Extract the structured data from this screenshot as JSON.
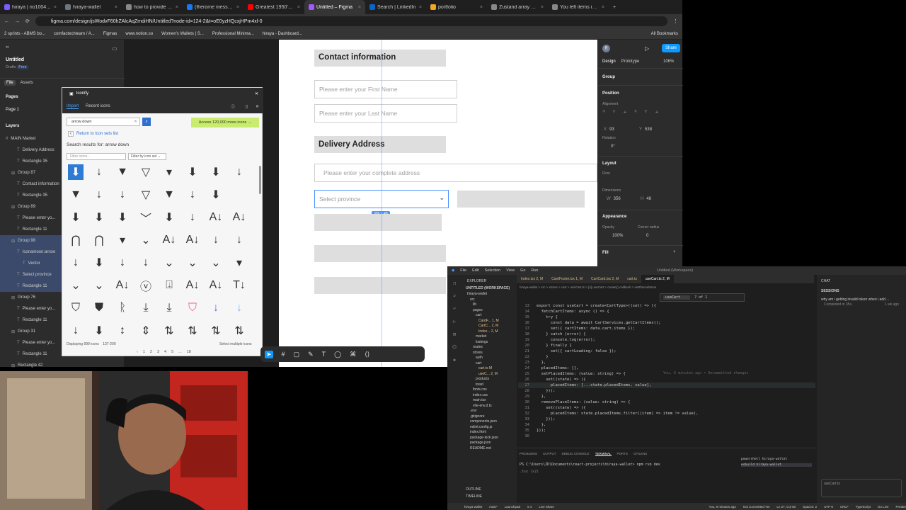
{
  "browser": {
    "tabs": [
      {
        "label": "hiraya | rio1004's Org",
        "color": "#7c5cff"
      },
      {
        "label": "hiraya-wallet",
        "color": "#6e7681"
      },
      {
        "label": "how to provide the lin",
        "color": "#888888"
      },
      {
        "label": "(fherome messaged TH",
        "color": "#1877f2"
      },
      {
        "label": "Greatest 1950's Sci",
        "color": "#ff0000"
      },
      {
        "label": "Untitled – Figma",
        "color": "#a259ff",
        "active": true
      },
      {
        "label": "Search | LinkedIn",
        "color": "#0a66c2"
      },
      {
        "label": "portfolio",
        "color": "#f5a623"
      },
      {
        "label": "Zustand array push g",
        "color": "#888888"
      },
      {
        "label": "You left items in your",
        "color": "#888888"
      }
    ],
    "url": "figma.com/design/jsWodvF60hZAlcAqZmdiHN/Untitled?node-id=124-2&t=oE0yzHQcxjHPm4xl-0",
    "bookmarks": [
      "2 sprints - ABMS bo...",
      "comfactechteam / A...",
      "Figmas",
      "www.notion.so",
      "Women's Wallets | S...",
      "Professional Minima...",
      "hiraya - Dashboard..."
    ],
    "all_bookmarks": "All Bookmarks"
  },
  "figma": {
    "file_title": "Untitled",
    "drafts": "Drafts",
    "free_badge": "Free",
    "tabs": [
      "File",
      "Assets"
    ],
    "pages_heading": "Pages",
    "page_item": "Page 1",
    "layers_heading": "Layers",
    "layers": [
      {
        "label": "MAIN Market",
        "indent": 0,
        "selected": false
      },
      {
        "label": "Delivery Address",
        "indent": 2,
        "selected": false
      },
      {
        "label": "Rectangle 35",
        "indent": 2,
        "selected": false
      },
      {
        "label": "Group 87",
        "indent": 1,
        "selected": false
      },
      {
        "label": "Contact information",
        "indent": 2,
        "selected": false
      },
      {
        "label": "Rectangle 35",
        "indent": 2,
        "selected": false
      },
      {
        "label": "Group 89",
        "indent": 1,
        "selected": false
      },
      {
        "label": "Please enter yo...",
        "indent": 2,
        "selected": false
      },
      {
        "label": "Rectangle 11",
        "indent": 2,
        "selected": false
      },
      {
        "label": "Group 98",
        "indent": 1,
        "selected": true
      },
      {
        "label": "Iconamoon:arrow",
        "indent": 2,
        "selected": true
      },
      {
        "label": "Vector",
        "indent": 3,
        "selected": true
      },
      {
        "label": "Select province",
        "indent": 2,
        "selected": true
      },
      {
        "label": "Rectangle 11",
        "indent": 2,
        "selected": true
      },
      {
        "label": "Group 76",
        "indent": 1,
        "selected": false
      },
      {
        "label": "Please enter yo...",
        "indent": 2,
        "selected": false
      },
      {
        "label": "Rectangle 11",
        "indent": 2,
        "selected": false
      },
      {
        "label": "Group 31",
        "indent": 1,
        "selected": false
      },
      {
        "label": "Please enter yo...",
        "indent": 2,
        "selected": false
      },
      {
        "label": "Rectangle 11",
        "indent": 2,
        "selected": false
      },
      {
        "label": "Rectangle 42",
        "indent": 1,
        "selected": false
      }
    ],
    "canvas": {
      "contact_heading": "Contact information",
      "first_name_ph": "Please enter your First Name",
      "last_name_ph": "Please enter your Last Name",
      "delivery_heading": "Delivery Address",
      "address_ph": "Please enter your complete address",
      "province_ph": "Select province",
      "size_badge": "356 × 48"
    },
    "right": {
      "avatar": "R",
      "share": "Share",
      "tab_design": "Design",
      "tab_prototype": "Prototype",
      "zoom": "106%",
      "group_label": "Group",
      "position": "Position",
      "alignment": "Alignment",
      "x_label": "X",
      "x_value": "93",
      "y_label": "Y",
      "y_value": "538",
      "rotation": "Rotation",
      "rotation_value": "0°",
      "layout": "Layout",
      "flow": "Flow",
      "dimensions": "Dimensions",
      "w_label": "W",
      "w_value": "356",
      "h_label": "H",
      "h_value": "48",
      "appearance": "Appearance",
      "opacity": "Opacity",
      "opacity_value": "100%",
      "corner_radius": "Corner radius",
      "corner_value": "0",
      "fill": "Fill"
    }
  },
  "iconify": {
    "title": "Iconify",
    "tab_import": "Import",
    "tab_recent": "Recent icons",
    "search_value": "arrow down",
    "promo": "Access 120,000 more icons →",
    "return_link": "Return to icon sets list",
    "results_heading": "Search results for: arrow down",
    "filter_ph": "Filter icons...",
    "filter_by_set": "Filter by icon set",
    "displaying": "Displaying 999 icons",
    "range": "137-200",
    "pages": [
      "1",
      "2",
      "3",
      "4",
      "5",
      "...",
      "18"
    ],
    "select_multiple": "Select multiple icons",
    "glyphs": [
      "⬇",
      "↓",
      "▼",
      "▽",
      "▾",
      "⬇",
      "⬇",
      "↓",
      "▼",
      "↓",
      "↓",
      "▽",
      "▼",
      "↓",
      "⬇",
      "",
      "⬇",
      "⬇",
      "⬇",
      "﹀",
      "⬇",
      "↓",
      "A↓",
      "A↓",
      "⋂",
      "⋂",
      "▾",
      "⌄",
      "A↓",
      "A↓",
      "↓",
      "↓",
      "↓",
      "⬇",
      "↓",
      "↓",
      "⌄",
      "⌄",
      "⌄",
      "▾",
      "⌄",
      "⌄",
      "A↓",
      "ⓥ",
      "⍗",
      "A↓",
      "A↓",
      "T↓",
      "⛉",
      "⛊",
      "ᚱ",
      "⤓",
      "⤓",
      "⛉",
      "↓",
      "↓",
      "↓",
      "⬇",
      "↕",
      "⇕",
      "⇅",
      "⇅",
      "⇅",
      "⇅"
    ]
  },
  "vscode": {
    "menu": [
      "File",
      "Edit",
      "Selection",
      "View",
      "Go",
      "Run"
    ],
    "window_title": "Untitled (Workspace)",
    "tabs": [
      "Index.tsx 2, M",
      "CardFooter.tsx 1, M",
      "CartCard.tsx 2, M",
      "cart.ts",
      "useCart.ts 2, M"
    ],
    "breadcrumb": "hiraya-wallet > src > stores > cart > useCart.ts > [o] useCart > create() callback > setPlacedItems",
    "explorer": "EXPLORER",
    "workspace": "UNTITLED (WORKSPACE)",
    "tree": [
      "hiraya-wallet",
      "src",
      "lib",
      "pages",
      "cart",
      "CardF... 1, M",
      "CartC... 2, M",
      "Index... 2, M",
      "market",
      "lostmgs",
      "routes",
      "stores",
      "auth",
      "cart",
      "cart.ts M",
      "useC... 2, M",
      "products",
      "toast",
      "fonts.css",
      "index.css",
      "main.tsx",
      "vite-env.d.ts",
      ".env",
      ".gitignore",
      "components.json",
      "eslint.config.js",
      "index.html",
      "package-lock.json",
      "package.json",
      "README.md"
    ],
    "find_value": "useCart",
    "find_count": "? of 1",
    "code": [
      {
        "n": "13",
        "t": "export const useCart = create<CartType>((set) => ({"
      },
      {
        "n": "14",
        "t": "  fetchCartItems: async () => {"
      },
      {
        "n": "15",
        "t": "    try {"
      },
      {
        "n": "16",
        "t": "      const data = await CartServices.getCartItems();"
      },
      {
        "n": "17",
        "t": "      set({ cartItems: data.cart.items });"
      },
      {
        "n": "18",
        "t": "    } catch (error) {"
      },
      {
        "n": "19",
        "t": "      console.log(error);"
      },
      {
        "n": "20",
        "t": "    } finally {"
      },
      {
        "n": "21",
        "t": "      set({ cartLoading: false });"
      },
      {
        "n": "22",
        "t": "    }"
      },
      {
        "n": "23",
        "t": "  },"
      },
      {
        "n": "24",
        "t": "  placedItems: [],"
      },
      {
        "n": "25",
        "t": "  setPlacedItems: (value: string) => {"
      },
      {
        "n": "26",
        "t": "    set((state) => ({"
      },
      {
        "n": "27",
        "t": "      placedItems: [...state.placedItems, value],"
      },
      {
        "n": "28",
        "t": "    }));"
      },
      {
        "n": "29",
        "t": "  },"
      },
      {
        "n": "30",
        "t": "  removePlaceItems: (value: string) => {"
      },
      {
        "n": "31",
        "t": "    set((state) => ({"
      },
      {
        "n": "32",
        "t": "      placedItems: state.placedItems.filter((item) => item != value),"
      },
      {
        "n": "33",
        "t": "    }));"
      },
      {
        "n": "34",
        "t": "  },"
      },
      {
        "n": "35",
        "t": "}));"
      },
      {
        "n": "36",
        "t": ""
      }
    ],
    "blame": "You, 6 minutes ago • Uncommitted changes",
    "panel_tabs": [
      "PROBLEMS",
      "OUTPUT",
      "DEBUG CONSOLE",
      "TERMINAL",
      "PORTS",
      "GITLENS"
    ],
    "terminal_line1": "PS C:\\Users\\ZD\\Documents\\react-projects\\hiraya-wallet> npm run dev",
    "terminal_line2": ".tsx (x2)",
    "terminals": [
      "powershell hiraya-wallet",
      "esbuild hiraya-wallet"
    ],
    "chat_title": "CHAT",
    "sessions": "SESSIONS",
    "chat_item": "why am i getting invalid token when i add ...",
    "chat_sub": "Completed in 35s.",
    "chat_time": "1 wk ago",
    "chat_input_ref": "useCart.ts",
    "status": [
      "hiraya-wallet",
      "main*",
      "Launchpad",
      "5 4",
      "Live Share"
    ],
    "status_right": [
      "You, 9 minutes ago",
      "Not Committed Yet",
      "Ln 27, Col 50",
      "Spaces: 2",
      "UTF-8",
      "CRLF",
      "TypeScript",
      "Go Live",
      "Prettier"
    ],
    "outline": "OUTLINE",
    "timeline": "TIMELINE"
  }
}
